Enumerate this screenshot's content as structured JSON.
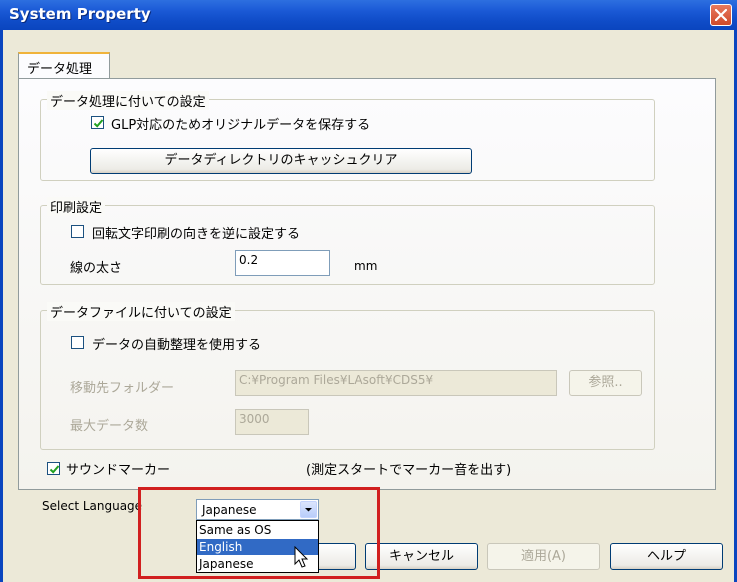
{
  "window": {
    "title": "System Property"
  },
  "tabs": [
    {
      "label": "データ処理"
    }
  ],
  "group_data_processing": {
    "legend": "データ処理に付いての設定",
    "glp_checkbox": {
      "label": "GLP対応のためオリジナルデータを保存する",
      "checked": true
    },
    "clear_cache_button": "データディレクトリのキャッシュクリア"
  },
  "group_print": {
    "legend": "印刷設定",
    "reverse_rotation_checkbox": {
      "label": "回転文字印刷の向きを逆に設定する",
      "checked": false
    },
    "line_width_label": "線の太さ",
    "line_width_value": "0.2",
    "line_width_unit": "mm"
  },
  "group_data_file": {
    "legend": "データファイルに付いての設定",
    "auto_organize_checkbox": {
      "label": "データの自動整理を使用する",
      "checked": false
    },
    "dest_folder_label": "移動先フォルダー",
    "dest_folder_value": "C:¥Program Files¥LAsoft¥CDS5¥",
    "browse_button": "参照..",
    "max_data_label": "最大データ数",
    "max_data_value": "3000"
  },
  "sound_marker": {
    "label": "サウンドマーカー",
    "checked": true,
    "note": "(測定スタートでマーカー音を出す)"
  },
  "language": {
    "label": "Select Language",
    "selected": "Japanese",
    "options": [
      "Same as OS",
      "English",
      "Japanese"
    ],
    "highlighted": "English"
  },
  "footer_buttons": {
    "cancel": "キャンセル",
    "apply": "適用(A)",
    "help": "ヘルプ"
  },
  "colors": {
    "titlebar": "#0a45bf",
    "highlight": "#316ac5",
    "annotation_box": "#d11f1f"
  }
}
